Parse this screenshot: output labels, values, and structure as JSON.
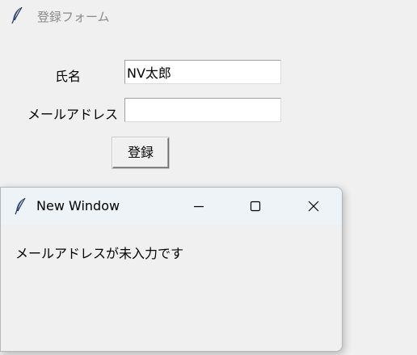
{
  "main_window": {
    "title": "登録フォーム",
    "icon": "feather-icon"
  },
  "form": {
    "name_label": "氏名",
    "name_value": "NV太郎",
    "email_label": "メールアドレス",
    "email_value": "",
    "submit_label": "登録"
  },
  "popup": {
    "title": "New Window",
    "icon": "feather-icon",
    "message": "メールアドレスが未入力です",
    "controls": [
      "minimize-icon",
      "maximize-icon",
      "close-icon"
    ]
  }
}
